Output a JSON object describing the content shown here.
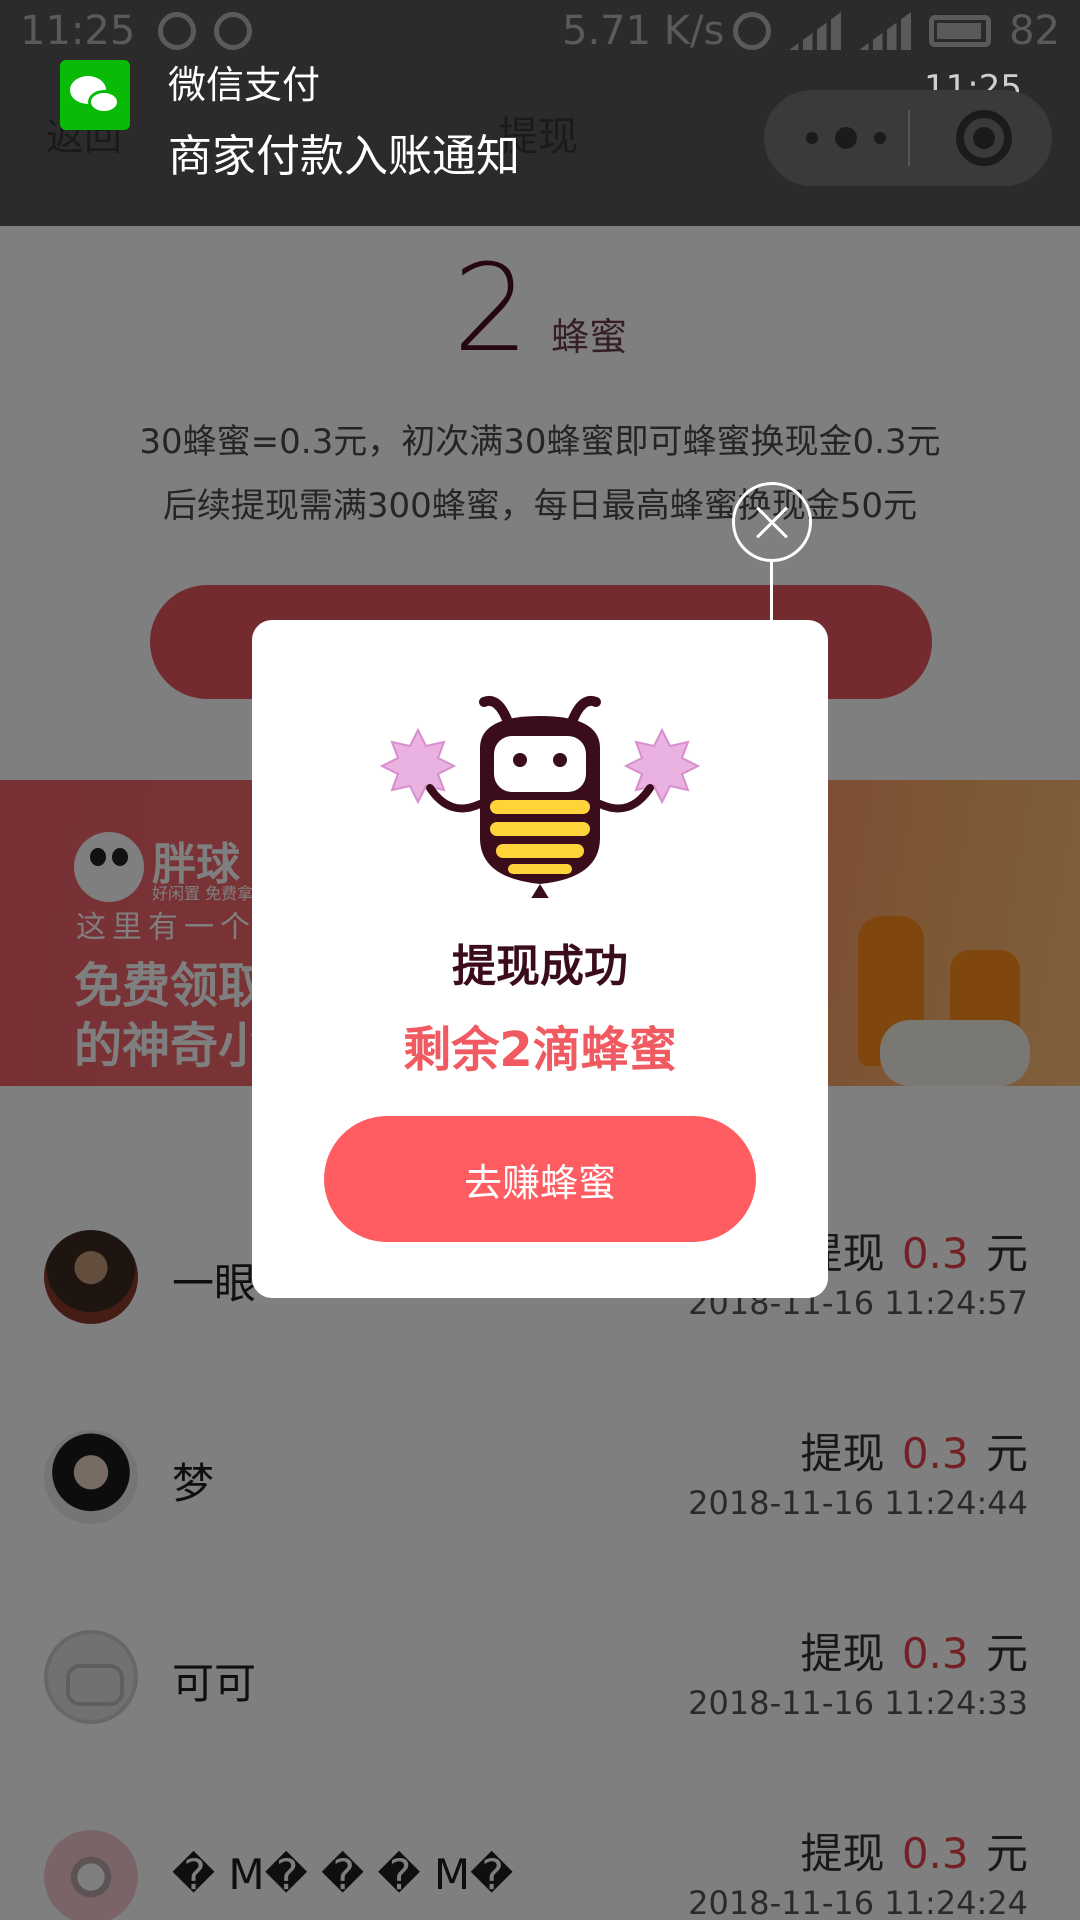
{
  "statusbar": {
    "time": "11:25",
    "speed": "5.71 K/s",
    "battery": "82"
  },
  "nav": {
    "back": "返回",
    "title": "提现"
  },
  "notification": {
    "app": "微信支付",
    "message": "商家付款入账通知",
    "time": "11:25"
  },
  "balance": {
    "value": "2",
    "unit": "蜂蜜"
  },
  "rules": [
    "30蜂蜜=0.3元，初次满30蜂蜜即可蜂蜜换现金0.3元",
    "后续提现需满300蜂蜜，每日最高蜂蜜换现金50元"
  ],
  "banner": {
    "brand": "胖球",
    "brand_sub": "好闲置 免费拿",
    "line1": "这里有一个",
    "line2": "免费领取",
    "line3": "的神奇小"
  },
  "records": [
    {
      "name": "一眼",
      "label": "提现",
      "amount": "0.3",
      "unit": "元",
      "date": "2018-11-16 11:24:57"
    },
    {
      "name": "梦",
      "label": "提现",
      "amount": "0.3",
      "unit": "元",
      "date": "2018-11-16 11:24:44"
    },
    {
      "name": "可可",
      "label": "提现",
      "amount": "0.3",
      "unit": "元",
      "date": "2018-11-16 11:24:33"
    },
    {
      "name": "� M� � � M�",
      "label": "提现",
      "amount": "0.3",
      "unit": "元",
      "date": "2018-11-16 11:24:24"
    }
  ],
  "modal": {
    "title": "提现成功",
    "subtitle": "剩余2滴蜂蜜",
    "button": "去赚蜂蜜"
  },
  "colors": {
    "accent": "#ff5d62",
    "title": "#3b0d1a",
    "amount": "#e8434c"
  }
}
